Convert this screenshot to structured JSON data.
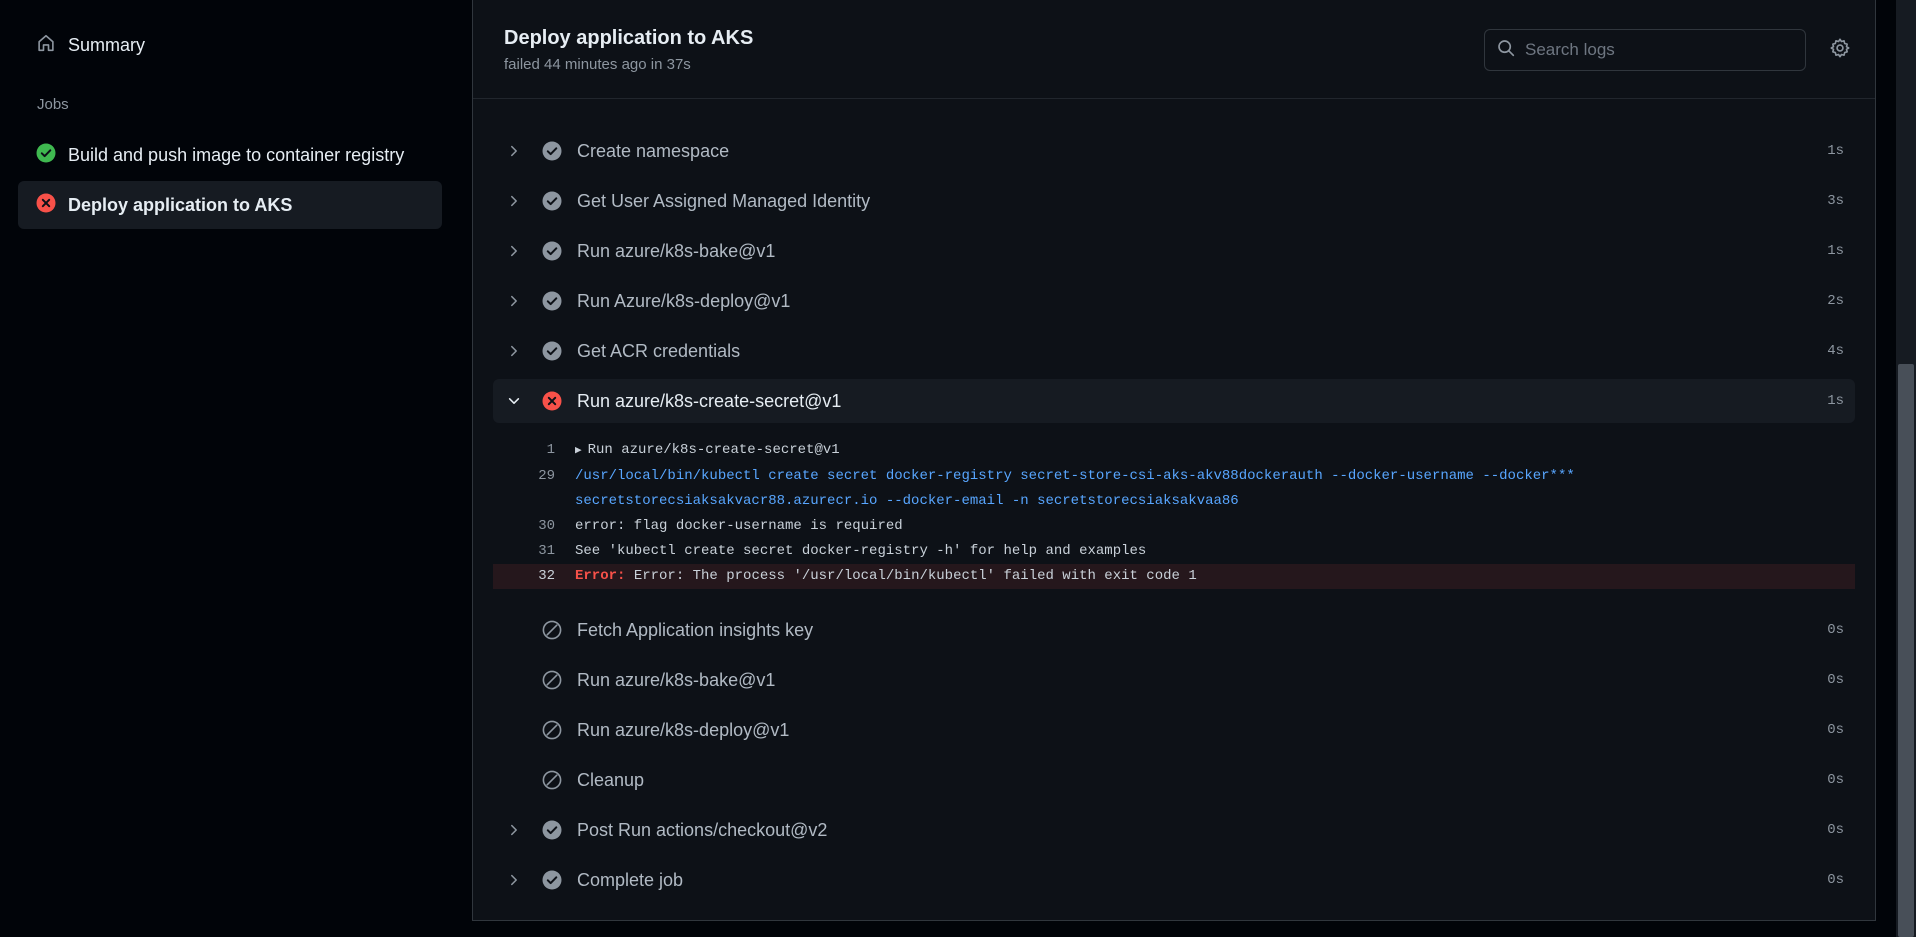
{
  "sidebar": {
    "summary_label": "Summary",
    "jobs_heading": "Jobs",
    "jobs": [
      {
        "label": "Build and push image to container registry",
        "status": "success"
      },
      {
        "label": "Deploy application to AKS",
        "status": "failure"
      }
    ]
  },
  "header": {
    "title": "Deploy application to AKS",
    "meta": "failed 44 minutes ago in 37s",
    "search_placeholder": "Search logs"
  },
  "steps": [
    {
      "name": "Create namespace",
      "duration": "1s",
      "status": "success"
    },
    {
      "name": "Get User Assigned Managed Identity",
      "duration": "3s",
      "status": "success"
    },
    {
      "name": "Run azure/k8s-bake@v1",
      "duration": "1s",
      "status": "success"
    },
    {
      "name": "Run Azure/k8s-deploy@v1",
      "duration": "2s",
      "status": "success"
    },
    {
      "name": "Get ACR credentials",
      "duration": "4s",
      "status": "success"
    },
    {
      "name": "Run azure/k8s-create-secret@v1",
      "duration": "1s",
      "status": "failure"
    },
    {
      "name": "Fetch Application insights key",
      "duration": "0s",
      "status": "skipped"
    },
    {
      "name": "Run azure/k8s-bake@v1",
      "duration": "0s",
      "status": "skipped"
    },
    {
      "name": "Run azure/k8s-deploy@v1",
      "duration": "0s",
      "status": "skipped"
    },
    {
      "name": "Cleanup",
      "duration": "0s",
      "status": "skipped"
    },
    {
      "name": "Post Run actions/checkout@v2",
      "duration": "0s",
      "status": "success"
    },
    {
      "name": "Complete job",
      "duration": "0s",
      "status": "success"
    }
  ],
  "log": [
    {
      "line": "1",
      "text": "Run azure/k8s-create-secret@v1"
    },
    {
      "line": "29",
      "text": "/usr/local/bin/kubectl create secret docker-registry secret-store-csi-aks-akv88dockerauth --docker-username  --docker***",
      "text2": "secretstorecsiaksakvacr88.azurecr.io --docker-email   -n secretstorecsiaksakvaa86"
    },
    {
      "line": "30",
      "text": "error: flag docker-username is required"
    },
    {
      "line": "31",
      "text": "See 'kubectl create secret docker-registry -h' for help and examples"
    },
    {
      "line": "32",
      "tag": "Error:",
      "text": " Error: The process '/usr/local/bin/kubectl' failed with exit code 1"
    }
  ],
  "colors": {
    "success": "#3fb950",
    "failure": "#f85149",
    "muted": "#8d96a0",
    "link": "#58a6ff"
  }
}
